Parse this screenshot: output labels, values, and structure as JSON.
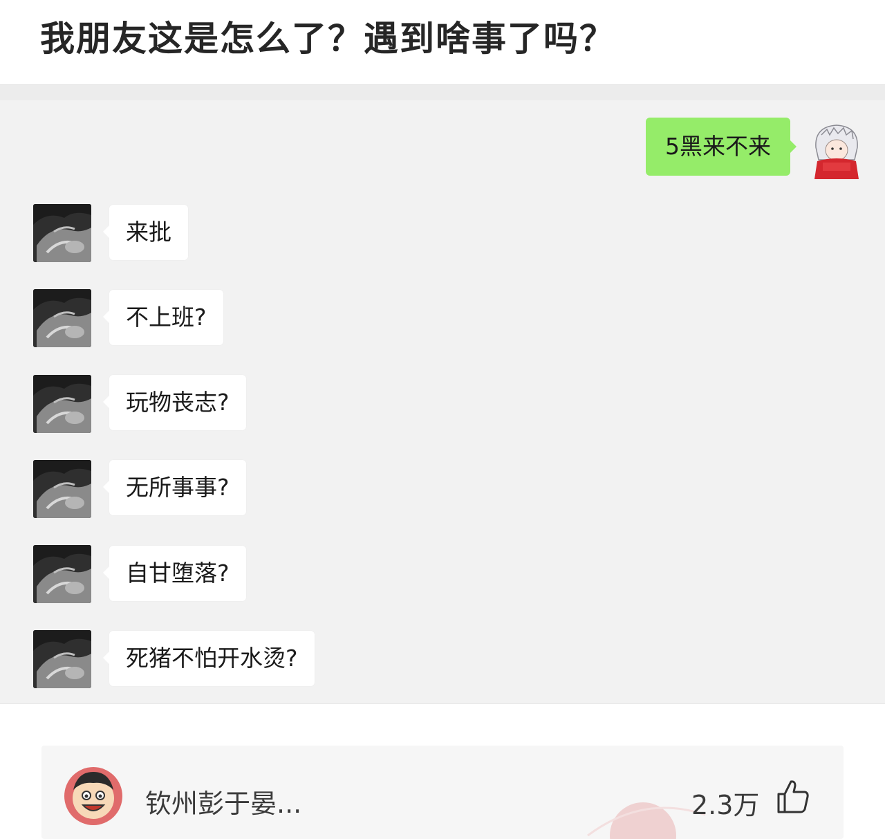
{
  "post": {
    "title": "我朋友这是怎么了？遇到啥事了吗？"
  },
  "chat": {
    "sent_message": "5黑来不来",
    "replies": [
      "来批",
      "不上班?",
      "玩物丧志?",
      "无所事事?",
      "自甘堕落?",
      "死猪不怕开水烫?"
    ]
  },
  "comment": {
    "username": "钦州彭于晏...",
    "likes": "2.3万",
    "icons": {
      "avatar": "cartoon-face-icon",
      "like": "thumbs-up-icon"
    }
  },
  "colors": {
    "chat_background": "#f2f2f2",
    "sent_bubble": "#95ec69",
    "received_bubble": "#ffffff",
    "watermark": "#e8a5a5"
  }
}
